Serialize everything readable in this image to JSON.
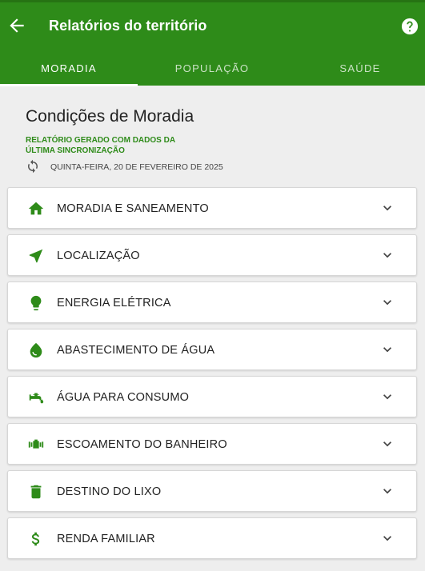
{
  "header": {
    "title": "Relatórios do território",
    "color": "#2e8b19"
  },
  "tabs": [
    {
      "label": "MORADIA",
      "active": true
    },
    {
      "label": "POPULAÇÃO",
      "active": false
    },
    {
      "label": "SAÚDE",
      "active": false
    }
  ],
  "page": {
    "title": "Condições de Moradia",
    "note_line1": "RELATÓRIO GERADO COM DADOS DA",
    "note_line2": "ÚLTIMA SINCRONIZAÇÃO",
    "sync_date": "QUINTA-FEIRA, 20 DE FEVEREIRO DE 2025"
  },
  "sections": [
    {
      "label": "MORADIA E SANEAMENTO",
      "icon": "home-icon"
    },
    {
      "label": "LOCALIZAÇÃO",
      "icon": "navigation-icon"
    },
    {
      "label": "ENERGIA ELÉTRICA",
      "icon": "lightbulb-icon"
    },
    {
      "label": "ABASTECIMENTO DE ÁGUA",
      "icon": "water-drop-icon"
    },
    {
      "label": "ÁGUA PARA CONSUMO",
      "icon": "faucet-icon"
    },
    {
      "label": "ESCOAMENTO DO BANHEIRO",
      "icon": "pipe-icon"
    },
    {
      "label": "DESTINO DO LIXO",
      "icon": "trash-icon"
    },
    {
      "label": "RENDA FAMILIAR",
      "icon": "dollar-icon"
    }
  ]
}
